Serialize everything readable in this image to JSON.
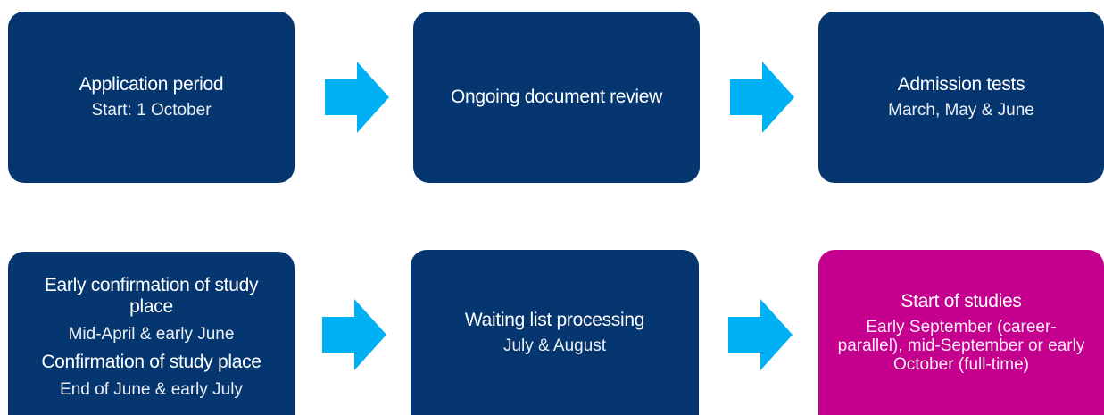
{
  "colors": {
    "box_primary": "#053670",
    "box_highlight": "#c6008e",
    "arrow": "#00b0f5",
    "text": "#ffffff"
  },
  "steps": [
    {
      "title": "Application period",
      "subtitle": "Start: 1 October"
    },
    {
      "title": "Ongoing document review"
    },
    {
      "title": "Admission tests",
      "subtitle": "March, May & June"
    },
    {
      "title": "Early confirmation of study place",
      "subtitle": "Mid-April & early June",
      "title2": "Confirmation of study place",
      "subtitle2": "End of June & early July"
    },
    {
      "title": "Waiting list processing",
      "subtitle": "July & August"
    },
    {
      "title": "Start of studies",
      "subtitle": "Early September (career-parallel), mid-September or early October (full-time)"
    }
  ]
}
